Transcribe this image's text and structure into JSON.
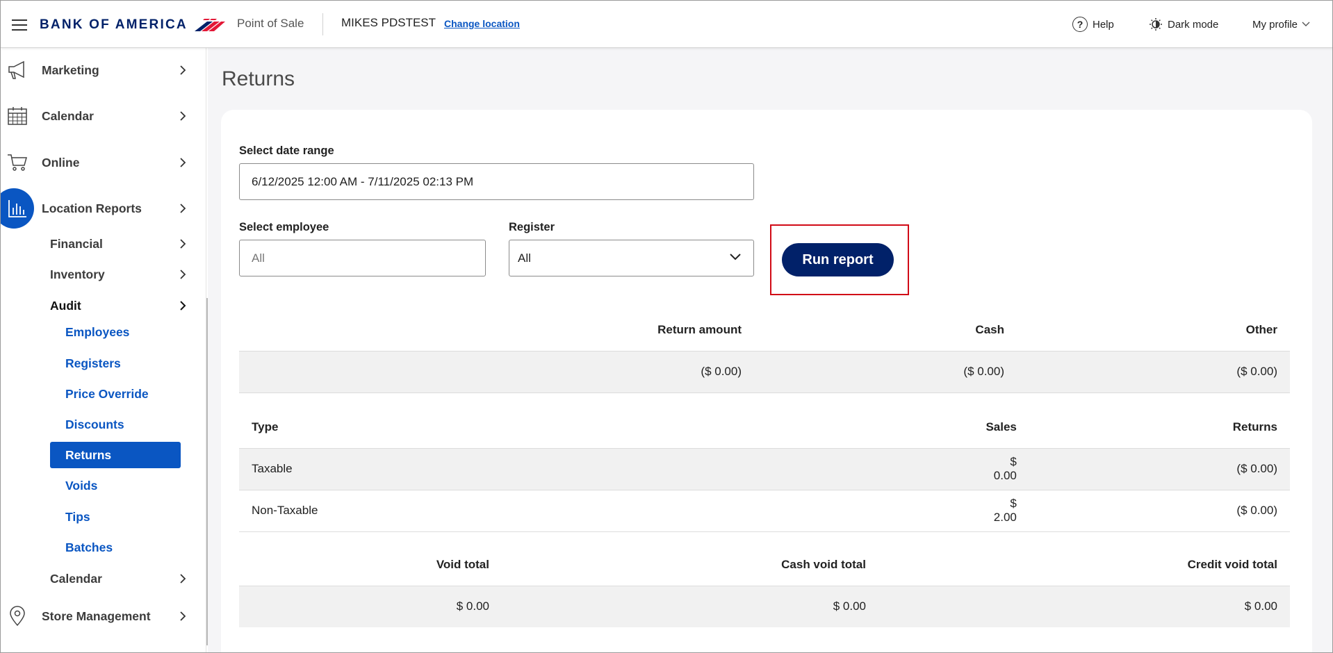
{
  "header": {
    "brand": "BANK OF AMERICA",
    "app_name": "Point of Sale",
    "location_name": "MIKES PDSTEST",
    "change_location": "Change location",
    "help": "Help",
    "dark_mode": "Dark mode",
    "my_profile": "My profile"
  },
  "sidebar": {
    "items": [
      {
        "label": "Marketing",
        "icon": "megaphone-icon"
      },
      {
        "label": "Calendar",
        "icon": "calendar-icon"
      },
      {
        "label": "Online",
        "icon": "cart-icon"
      },
      {
        "label": "Location Reports",
        "icon": "bar-chart-icon"
      },
      {
        "label": "Store Management",
        "icon": "location-pin-icon"
      }
    ],
    "sub": {
      "financial": "Financial",
      "inventory": "Inventory",
      "audit": "Audit",
      "calendar": "Calendar"
    },
    "audit_items": [
      "Employees",
      "Registers",
      "Price Override",
      "Discounts",
      "Returns",
      "Voids",
      "Tips",
      "Batches"
    ],
    "active_item": "Returns",
    "accent_color": "#0a56c2"
  },
  "main": {
    "title": "Returns",
    "date_range_label": "Select date range",
    "date_range_value": "6/12/2025 12:00 AM - 7/11/2025 02:13 PM",
    "employee_label": "Select employee",
    "employee_placeholder": "All",
    "register_label": "Register",
    "register_value": "All",
    "run_report": "Run report",
    "summary": {
      "headers": [
        "Return amount",
        "Cash",
        "Other"
      ],
      "row": [
        "($ 0.00)",
        "($ 0.00)",
        "($ 0.00)"
      ]
    },
    "types": {
      "headers": [
        "Type",
        "Sales",
        "Returns"
      ],
      "rows": [
        [
          "Taxable",
          "$ 0.00",
          "($ 0.00)"
        ],
        [
          "Non-Taxable",
          "$ 2.00",
          "($ 0.00)"
        ]
      ]
    },
    "voids": {
      "headers": [
        "Void total",
        "Cash void total",
        "Credit void total"
      ],
      "row": [
        "$ 0.00",
        "$ 0.00",
        "$ 0.00"
      ]
    }
  },
  "colors": {
    "brand_navy": "#012169",
    "highlight_red": "#d10a16"
  }
}
